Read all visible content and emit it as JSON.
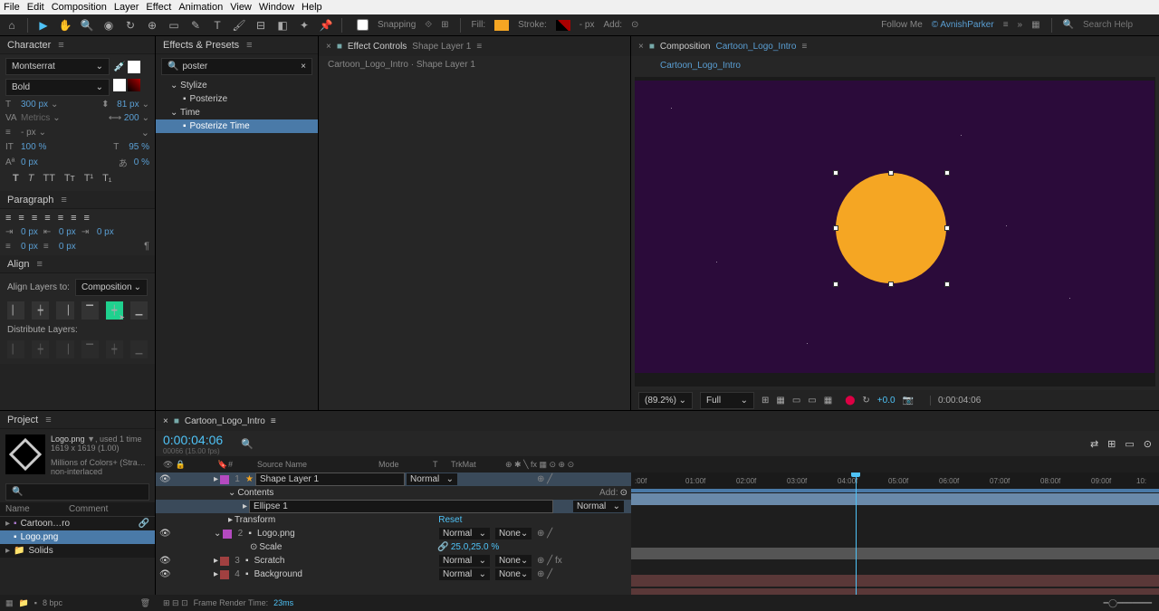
{
  "menu": [
    "File",
    "Edit",
    "Composition",
    "Layer",
    "Effect",
    "Animation",
    "View",
    "Window",
    "Help"
  ],
  "toolbar": {
    "snapping": "Snapping",
    "fill": "Fill:",
    "fill_color": "#f5a623",
    "stroke": "Stroke:",
    "stroke_px": "- px",
    "add": "Add:",
    "follow": "Follow Me",
    "user": "AvnishParker",
    "search": "Search Help"
  },
  "character": {
    "title": "Character",
    "font": "Montserrat",
    "weight": "Bold",
    "size": "300 px",
    "leading": "81 px",
    "tracking": "200",
    "kerning": "Metrics",
    "strokepx": "- px",
    "vscale": "100 %",
    "hscale": "95 %",
    "baseline": "0 px",
    "tsumi": "0 %"
  },
  "paragraph": {
    "title": "Paragraph",
    "indent": "0 px"
  },
  "align": {
    "title": "Align",
    "layers_to": "Align Layers to:",
    "target": "Composition",
    "distribute": "Distribute Layers:"
  },
  "effects": {
    "title": "Effects & Presets",
    "search": "poster",
    "cat1": "Stylize",
    "item1": "Posterize",
    "cat2": "Time",
    "item2": "Posterize Time"
  },
  "ec": {
    "title": "Effect Controls",
    "layer": "Shape Layer 1",
    "crumb": "Cartoon_Logo_Intro · Shape Layer 1"
  },
  "comp": {
    "title": "Composition",
    "name": "Cartoon_Logo_Intro",
    "tab": "Cartoon_Logo_Intro",
    "zoom": "(89.2%)",
    "res": "Full",
    "exposure": "+0.0",
    "time": "0:00:04:06"
  },
  "project": {
    "title": "Project",
    "asset": "Logo.png",
    "used": ", used 1 time",
    "dims": "1619 x 1619 (1.00)",
    "colors": "Millions of Colors+ (Stra…",
    "interlace": "non-interlaced",
    "col_name": "Name",
    "col_comment": "Comment",
    "items": [
      "Cartoon…ro",
      "Logo.png",
      "Solids"
    ],
    "bpc": "8 bpc"
  },
  "timeline": {
    "tab": "Cartoon_Logo_Intro",
    "timecode": "0:00:04:06",
    "frames": "00066 (15.00 fps)",
    "col_num": "#",
    "col_src": "Source Name",
    "col_mode": "Mode",
    "col_t": "T",
    "col_trk": "TrkMat",
    "add": "Add:",
    "layers": [
      {
        "num": "1",
        "name": "Shape Layer 1",
        "mode": "Normal",
        "color": "#b44ac0"
      },
      {
        "num": "2",
        "name": "Logo.png",
        "mode": "Normal",
        "trk": "None",
        "color": "#b44ac0"
      },
      {
        "num": "3",
        "name": "Scratch",
        "mode": "Normal",
        "trk": "None",
        "color": "#a04040"
      },
      {
        "num": "4",
        "name": "Background",
        "mode": "Normal",
        "trk": "None",
        "color": "#a04040"
      }
    ],
    "contents": "Contents",
    "ellipse": "Ellipse 1",
    "transform": "Transform",
    "reset": "Reset",
    "scale": "Scale",
    "scale_val": "25.0,25.0 %",
    "ruler": [
      ":00f",
      "01:00f",
      "02:00f",
      "03:00f",
      "04:00f",
      "05:00f",
      "06:00f",
      "07:00f",
      "08:00f",
      "09:00f",
      "10:"
    ],
    "render": "Frame Render Time:",
    "render_ms": "23ms"
  }
}
